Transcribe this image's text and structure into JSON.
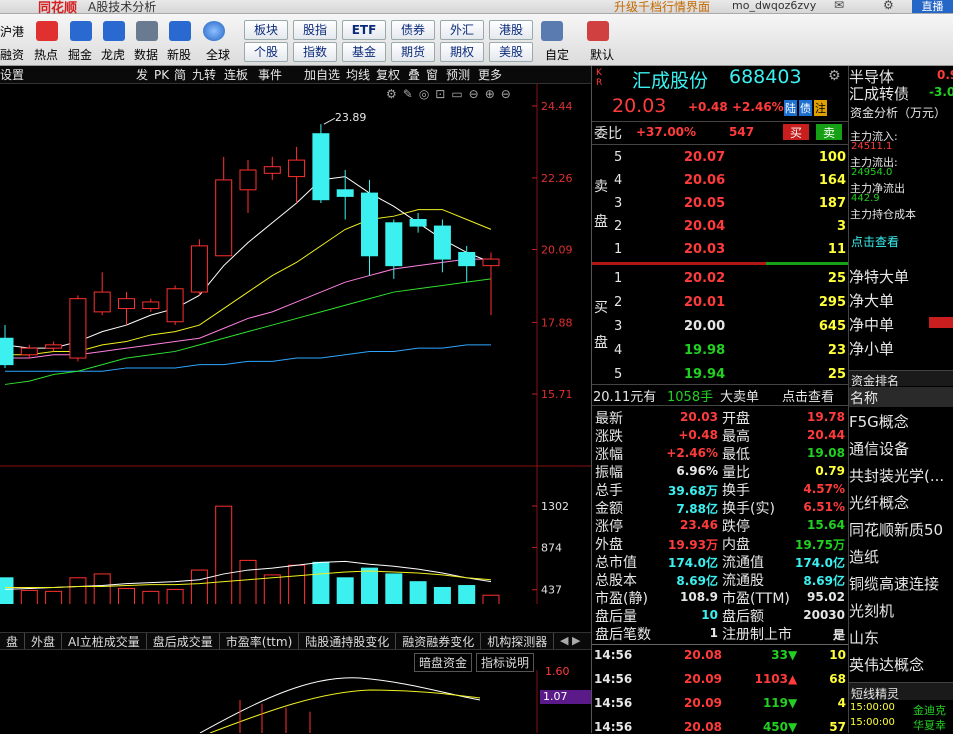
{
  "window": {
    "left_logo": "同花顺",
    "title": "A股技术分析",
    "right_title": "升级千档行情界面",
    "user": "mo_dwqoz6zvy",
    "direct": "直播"
  },
  "toolbar": {
    "left_top": "沪港",
    "left_bottom": "融资",
    "icons": [
      "热点",
      "掘金",
      "龙虎",
      "数据",
      "新股",
      "全球"
    ],
    "grid_top": [
      "板块",
      "股指",
      "ETF",
      "债券",
      "外汇",
      "港股"
    ],
    "grid_bottom": [
      "个股",
      "指数",
      "基金",
      "期货",
      "期权",
      "美股"
    ],
    "custom": "自定",
    "default": "默认"
  },
  "chart_menu": [
    "发",
    "PK",
    "简",
    "九转",
    "连板",
    "事件",
    "加自选",
    "均线",
    "复权",
    "叠",
    "窗",
    "预测",
    "更多"
  ],
  "settings": "设置",
  "kline": {
    "price_ticks": [
      "24.44",
      "22.26",
      "20.09",
      "17.88",
      "15.71"
    ],
    "high_label": "23.89",
    "candles": [
      {
        "o": 17.4,
        "c": 16.6,
        "h": 17.8,
        "l": 16.5
      },
      {
        "o": 16.9,
        "c": 17.1,
        "h": 17.2,
        "l": 16.8
      },
      {
        "o": 17.1,
        "c": 17.2,
        "h": 17.3,
        "l": 17.0
      },
      {
        "o": 16.8,
        "c": 18.6,
        "h": 18.7,
        "l": 16.7
      },
      {
        "o": 18.2,
        "c": 18.8,
        "h": 19.4,
        "l": 18.1
      },
      {
        "o": 18.3,
        "c": 18.6,
        "h": 18.8,
        "l": 17.8
      },
      {
        "o": 18.3,
        "c": 18.5,
        "h": 18.6,
        "l": 18.2
      },
      {
        "o": 17.9,
        "c": 18.9,
        "h": 19.0,
        "l": 17.8
      },
      {
        "o": 18.8,
        "c": 20.2,
        "h": 20.4,
        "l": 18.7
      },
      {
        "o": 19.9,
        "c": 22.2,
        "h": 22.9,
        "l": 19.9
      },
      {
        "o": 21.9,
        "c": 22.5,
        "h": 22.8,
        "l": 21.2
      },
      {
        "o": 22.4,
        "c": 22.6,
        "h": 22.9,
        "l": 22.2
      },
      {
        "o": 22.3,
        "c": 22.8,
        "h": 23.2,
        "l": 21.5
      },
      {
        "o": 23.6,
        "c": 21.6,
        "h": 23.89,
        "l": 21.5
      },
      {
        "o": 21.9,
        "c": 21.7,
        "h": 22.5,
        "l": 21.0
      },
      {
        "o": 21.8,
        "c": 19.9,
        "h": 22.2,
        "l": 19.3
      },
      {
        "o": 20.9,
        "c": 19.6,
        "h": 21.0,
        "l": 19.2
      },
      {
        "o": 21.0,
        "c": 20.8,
        "h": 21.2,
        "l": 20.6
      },
      {
        "o": 20.8,
        "c": 19.8,
        "h": 21.0,
        "l": 19.4
      },
      {
        "o": 20.0,
        "c": 19.6,
        "h": 20.2,
        "l": 19.1
      },
      {
        "o": 19.6,
        "c": 19.8,
        "h": 20.0,
        "l": 18.1
      }
    ],
    "ma_white": [
      17.2,
      17.1,
      17.1,
      17.3,
      17.6,
      17.8,
      18.1,
      18.3,
      18.7,
      19.6,
      20.3,
      20.9,
      21.5,
      22.2,
      22.3,
      21.8,
      21.4,
      20.9,
      20.4,
      20.0,
      19.7
    ],
    "ma_yellow": [
      16.9,
      16.9,
      17.0,
      17.0,
      17.2,
      17.3,
      17.5,
      17.6,
      17.8,
      18.3,
      18.8,
      19.3,
      19.7,
      20.2,
      20.7,
      21.0,
      21.1,
      21.3,
      21.3,
      21.0,
      20.7
    ],
    "ma_pink": [
      16.8,
      16.8,
      16.9,
      16.9,
      17.0,
      17.1,
      17.2,
      17.3,
      17.4,
      17.7,
      18.0,
      18.2,
      18.5,
      18.8,
      19.1,
      19.3,
      19.5,
      19.6,
      19.7,
      19.8,
      19.8
    ],
    "ma_green": [
      16.0,
      16.1,
      16.3,
      16.4,
      16.6,
      16.8,
      16.9,
      17.0,
      17.2,
      17.4,
      17.6,
      17.8,
      18.0,
      18.2,
      18.4,
      18.6,
      18.8,
      18.9,
      19.0,
      19.1,
      19.2
    ],
    "ma_blue": [
      16.4,
      16.4,
      16.4,
      16.4,
      16.4,
      16.5,
      16.5,
      16.5,
      16.6,
      16.6,
      16.7,
      16.7,
      16.8,
      16.8,
      16.9,
      17.0,
      17.0,
      17.1,
      17.1,
      17.2,
      17.2
    ]
  },
  "volume": {
    "ticks": [
      "1302",
      "874",
      "437"
    ],
    "unit": "X1000",
    "values": [
      560,
      430,
      420,
      560,
      600,
      450,
      420,
      440,
      640,
      1300,
      740,
      590,
      690,
      720,
      560,
      660,
      600,
      520,
      460,
      480,
      380
    ],
    "ma_white": [
      440,
      450,
      460,
      470,
      480,
      500,
      510,
      520,
      540,
      600,
      640,
      660,
      690,
      720,
      730,
      700,
      680,
      650,
      610,
      560,
      520
    ],
    "ma_yellow": [
      460,
      460,
      460,
      470,
      470,
      480,
      490,
      490,
      500,
      520,
      540,
      560,
      580,
      600,
      620,
      630,
      620,
      610,
      590,
      560,
      540
    ]
  },
  "bottom_tabs": [
    "盘",
    "外盘",
    "AI立桩成交量",
    "盘后成交量",
    "市盈率(ttm)",
    "陆股通持股变化",
    "融资融券变化",
    "机构探测器"
  ],
  "indicator": {
    "dark_btn": "暗盘资金",
    "explain_btn": "指标说明",
    "tick_top": "1.60",
    "tick_mid": "1.07"
  },
  "stock": {
    "kr": "K R",
    "name": "汇成股份",
    "code": "688403",
    "price": "20.03",
    "change": "+0.48",
    "pct": "+2.46%",
    "tags": [
      "陆",
      "债",
      "注"
    ],
    "weibi_label": "委比",
    "weibi": "+37.00%",
    "weicha": "547",
    "buy": "买",
    "sell": "卖"
  },
  "sell_label": [
    "卖",
    "盘"
  ],
  "buy_label": [
    "买",
    "盘"
  ],
  "asks": [
    {
      "n": "5",
      "p": "20.07",
      "v": "100"
    },
    {
      "n": "4",
      "p": "20.06",
      "v": "164"
    },
    {
      "n": "3",
      "p": "20.05",
      "v": "187"
    },
    {
      "n": "2",
      "p": "20.04",
      "v": "3"
    },
    {
      "n": "1",
      "p": "20.03",
      "v": "11"
    }
  ],
  "bids": [
    {
      "n": "1",
      "p": "20.02",
      "v": "25"
    },
    {
      "n": "2",
      "p": "20.01",
      "v": "295"
    },
    {
      "n": "3",
      "p": "20.00",
      "v": "645"
    },
    {
      "n": "4",
      "p": "19.98",
      "v": "23"
    },
    {
      "n": "5",
      "p": "19.94",
      "v": "25"
    }
  ],
  "big_order": {
    "price": "20.11元有",
    "vol": "1058手",
    "label": "大卖单",
    "link": "点击查看"
  },
  "stats": [
    [
      "最新",
      "20.03",
      "开盘",
      "19.78"
    ],
    [
      "涨跌",
      "+0.48",
      "最高",
      "20.44"
    ],
    [
      "涨幅",
      "+2.46%",
      "最低",
      "19.08"
    ],
    [
      "振幅",
      "6.96%",
      "量比",
      "0.79"
    ],
    [
      "总手",
      "39.68万",
      "换手",
      "4.57%"
    ],
    [
      "金额",
      "7.88亿",
      "换手(实)",
      "6.51%"
    ],
    [
      "涨停",
      "23.46",
      "跌停",
      "15.64"
    ],
    [
      "外盘",
      "19.93万",
      "内盘",
      "19.75万"
    ],
    [
      "总市值",
      "174.0亿",
      "流通值",
      "174.0亿"
    ],
    [
      "总股本",
      "8.69亿",
      "流通股",
      "8.69亿"
    ],
    [
      "市盈(静)",
      "108.9",
      "市盈(TTM)",
      "95.02"
    ],
    [
      "盘后量",
      "10",
      "盘后额",
      "20030"
    ],
    [
      "盘后笔数",
      "1",
      "注册制上市",
      "是"
    ]
  ],
  "ticks": [
    {
      "t": "14:56",
      "p": "20.08",
      "v": "33",
      "dir": "down",
      "n": "10"
    },
    {
      "t": "14:56",
      "p": "20.09",
      "v": "1103",
      "dir": "up",
      "n": "68"
    },
    {
      "t": "14:56",
      "p": "20.09",
      "v": "119",
      "dir": "down",
      "n": "4"
    },
    {
      "t": "14:56",
      "p": "20.08",
      "v": "450",
      "dir": "down",
      "n": "57"
    }
  ],
  "side": {
    "top1": "半导体",
    "top1v": "0.9",
    "top2": "汇成转债",
    "top2v": "-3.0",
    "fund_title": "资金分析（万元）",
    "fund": [
      [
        "主力流入:",
        "24511.1"
      ],
      [
        "主力流出:",
        "24954.0"
      ],
      [
        "主力净流出",
        "442.9"
      ],
      [
        "主力持仓成本",
        ""
      ]
    ],
    "fund_link": "点击查看",
    "net": [
      "净特大单",
      "净大单",
      "净中单",
      "净小单"
    ],
    "rank_title": "资金排名",
    "rank_name": "名称",
    "ranks": [
      "F5G概念",
      "通信设备",
      "共封装光学(...",
      "光纤概念",
      "同花顺新质50",
      "造纸",
      "铜缆高速连接",
      "光刻机",
      "山东",
      "英伟达概念"
    ],
    "short_title": "短线精灵",
    "short": [
      [
        "15:00:00",
        "金迪克"
      ],
      [
        "15:00:00",
        "华夏幸"
      ]
    ]
  }
}
